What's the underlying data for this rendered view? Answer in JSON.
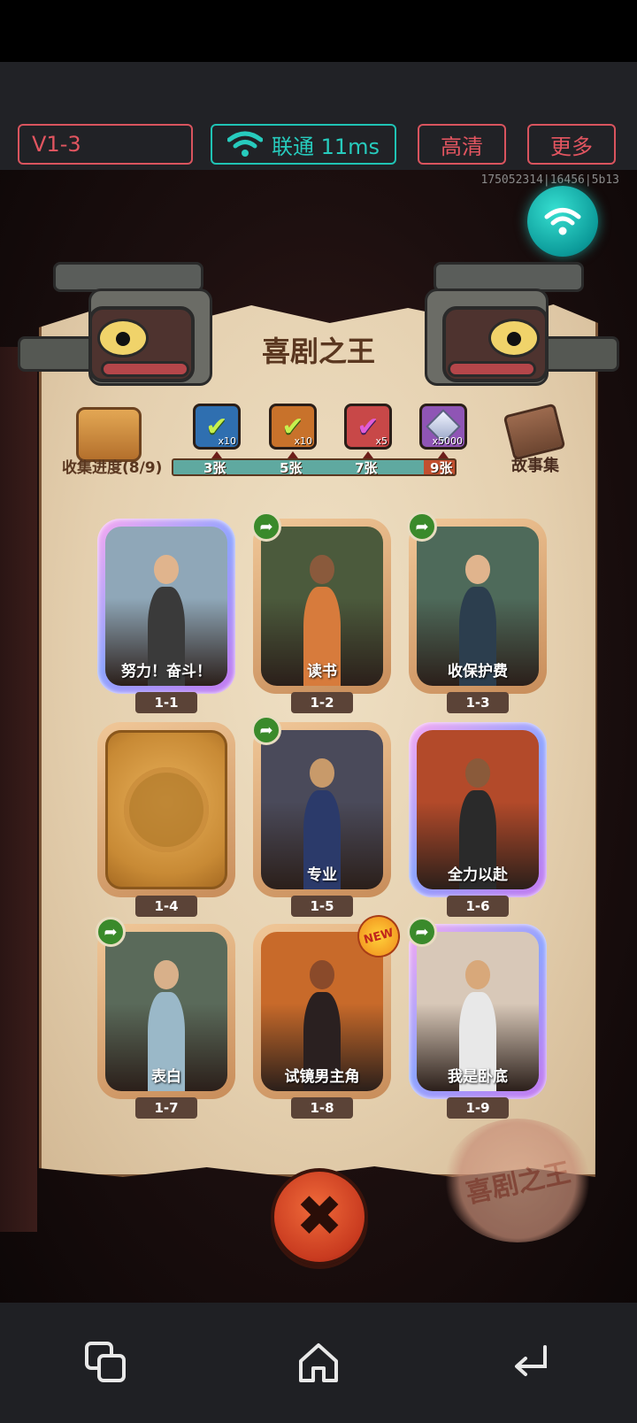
{
  "toolbar": {
    "version": "V1-3",
    "network": "联通 11ms",
    "quality": "高清",
    "more": "更多",
    "session_id": "175052314|16456|5b13"
  },
  "game": {
    "title": "喜剧之王",
    "collection_label": "收集进度(8/9)",
    "story_label": "故事集",
    "progress": {
      "collected": 8,
      "total": 9
    },
    "rewards": [
      {
        "icon": "check-ticket-icon",
        "qty": "x10",
        "threshold": "3张"
      },
      {
        "icon": "check-ticket-icon",
        "qty": "x10",
        "threshold": "5张"
      },
      {
        "icon": "rainbow-check-icon",
        "qty": "x5",
        "threshold": "7张"
      },
      {
        "icon": "crystal-icon",
        "qty": "x5000",
        "threshold": "9张"
      }
    ],
    "cards": [
      {
        "id": "1-1",
        "title": "努力！奋斗！",
        "rarity": "purple",
        "share": false,
        "new": false,
        "locked": false
      },
      {
        "id": "1-2",
        "title": "读书",
        "rarity": "normal",
        "share": true,
        "new": false,
        "locked": false
      },
      {
        "id": "1-3",
        "title": "收保护费",
        "rarity": "normal",
        "share": true,
        "new": false,
        "locked": false
      },
      {
        "id": "1-4",
        "title": "",
        "rarity": "locked",
        "share": false,
        "new": false,
        "locked": true
      },
      {
        "id": "1-5",
        "title": "专业",
        "rarity": "normal",
        "share": true,
        "new": false,
        "locked": false
      },
      {
        "id": "1-6",
        "title": "全力以赴",
        "rarity": "purple",
        "share": false,
        "new": false,
        "locked": false
      },
      {
        "id": "1-7",
        "title": "表白",
        "rarity": "normal",
        "share": true,
        "new": false,
        "locked": false
      },
      {
        "id": "1-8",
        "title": "试镜男主角",
        "rarity": "normal",
        "share": false,
        "new": true,
        "locked": false
      },
      {
        "id": "1-9",
        "title": "我是卧底",
        "rarity": "purple",
        "share": true,
        "new": false,
        "locked": false
      }
    ],
    "new_badge": "NEW",
    "seal_text": "喜剧之王"
  }
}
